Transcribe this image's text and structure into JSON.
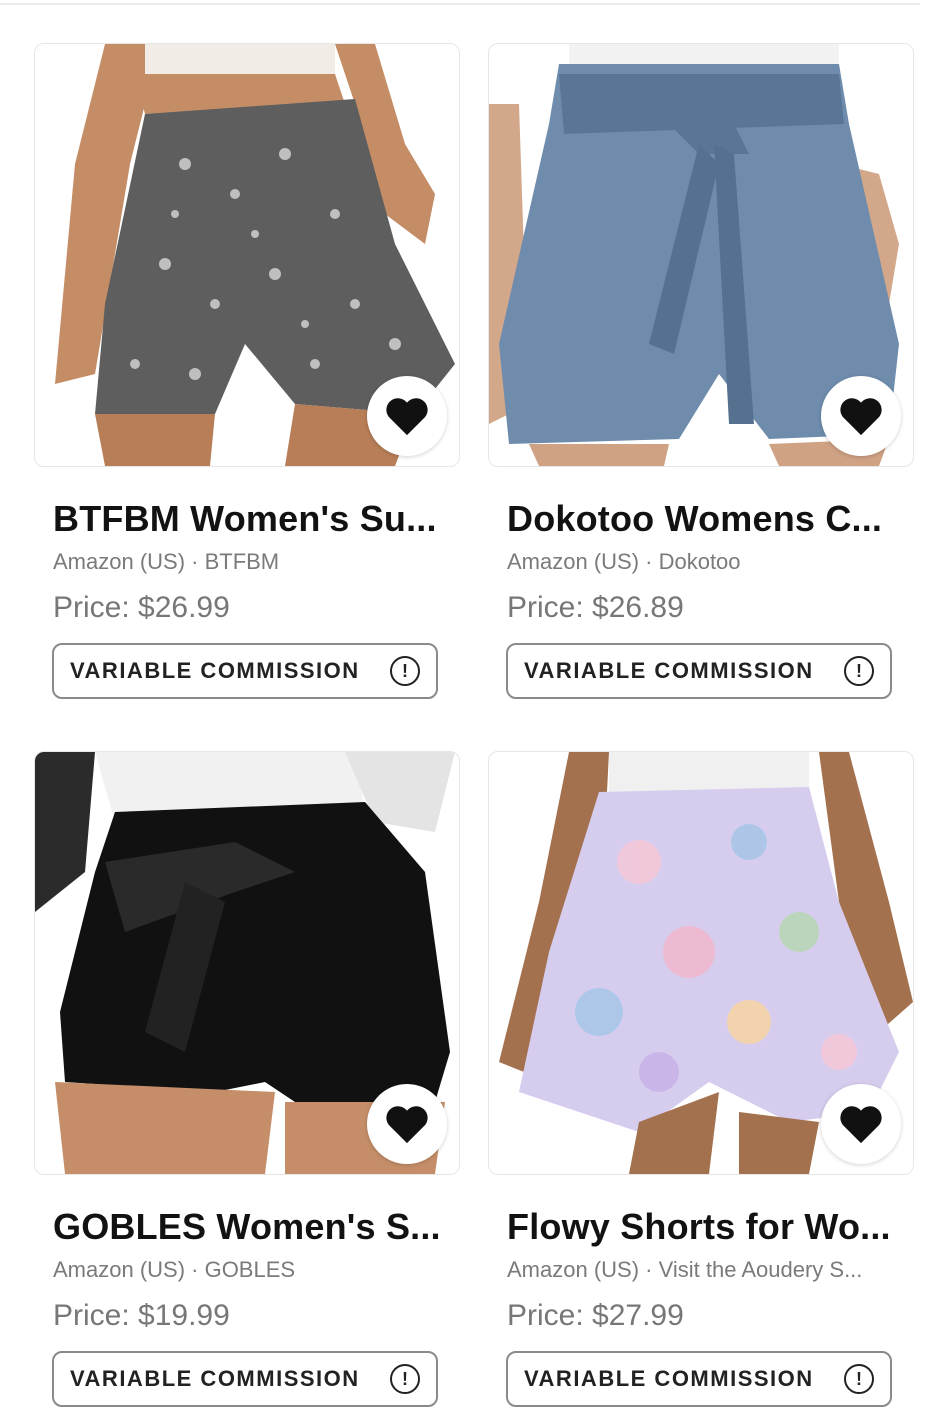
{
  "products": [
    {
      "title": "BTFBM Women's Su...",
      "source": "Amazon (US) · BTFBM",
      "price": "Price: $26.99",
      "commission_label": "VARIABLE COMMISSION",
      "image_icon": "printed-ruffle-shorts-image",
      "colors": {
        "primary": "#5e5e5e",
        "secondary": "#d8d8d8"
      }
    },
    {
      "title": "Dokotoo Womens C...",
      "source": "Amazon (US) · Dokotoo",
      "price": "Price: $26.89",
      "commission_label": "VARIABLE COMMISSION",
      "image_icon": "blue-tie-waist-shorts-image",
      "colors": {
        "primary": "#6f8cad",
        "secondary": "#5a7697"
      }
    },
    {
      "title": "GOBLES Women's S...",
      "source": "Amazon (US) · GOBLES",
      "price": "Price: $19.99",
      "commission_label": "VARIABLE COMMISSION",
      "image_icon": "black-tie-waist-shorts-image",
      "colors": {
        "primary": "#111111",
        "secondary": "#2a2a2a"
      }
    },
    {
      "title": "Flowy Shorts for Wo...",
      "source": "Amazon (US) · Visit the Aoudery S...",
      "price": "Price: $27.99",
      "commission_label": "VARIABLE COMMISSION",
      "image_icon": "floral-flowy-shorts-image",
      "colors": {
        "primary": "#c9b8e6",
        "secondary": "#f3c8d8"
      }
    }
  ],
  "favorite_icon": "heart-icon",
  "info_icon_glyph": "!"
}
